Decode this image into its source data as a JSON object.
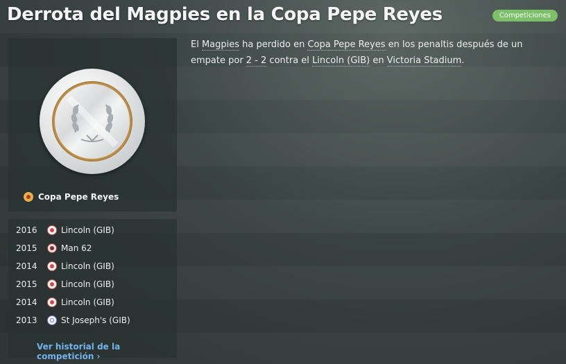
{
  "header": {
    "title": "Derrota del Magpies en la Copa Pepe Reyes",
    "badge": "Competiciones"
  },
  "competition": {
    "name": "Copa Pepe Reyes"
  },
  "history": {
    "rows": [
      {
        "year": "2016",
        "team": "Lincoln (GIB)",
        "icon": "lincoln-crest-icon"
      },
      {
        "year": "2015",
        "team": "Man 62",
        "icon": "man62-crest-icon"
      },
      {
        "year": "2014",
        "team": "Lincoln (GIB)",
        "icon": "lincoln-crest-icon"
      },
      {
        "year": "2015",
        "team": "Lincoln (GIB)",
        "icon": "lincoln-crest-icon"
      },
      {
        "year": "2014",
        "team": "Lincoln (GIB)",
        "icon": "lincoln-crest-icon"
      },
      {
        "year": "2013",
        "team": "St Joseph's (GIB)",
        "icon": "st-josephs-crest-icon"
      }
    ],
    "link": "Ver historial de la competición",
    "link_chevron": "›"
  },
  "story": {
    "t1": "El ",
    "team": "Magpies",
    "t2": " ha perdido en ",
    "competition": "Copa Pepe Reyes",
    "t3": " en los penaltis después de un empate por ",
    "score": "2 - 2",
    "t4": " contra el ",
    "opponent": "Lincoln (GIB)",
    "t5": " en ",
    "stadium": "Victoria Stadium",
    "t6": "."
  },
  "colors": {
    "accent_badge": "#7cc06a",
    "link": "#74b3ea",
    "trophy_gold": "#c3924a"
  }
}
